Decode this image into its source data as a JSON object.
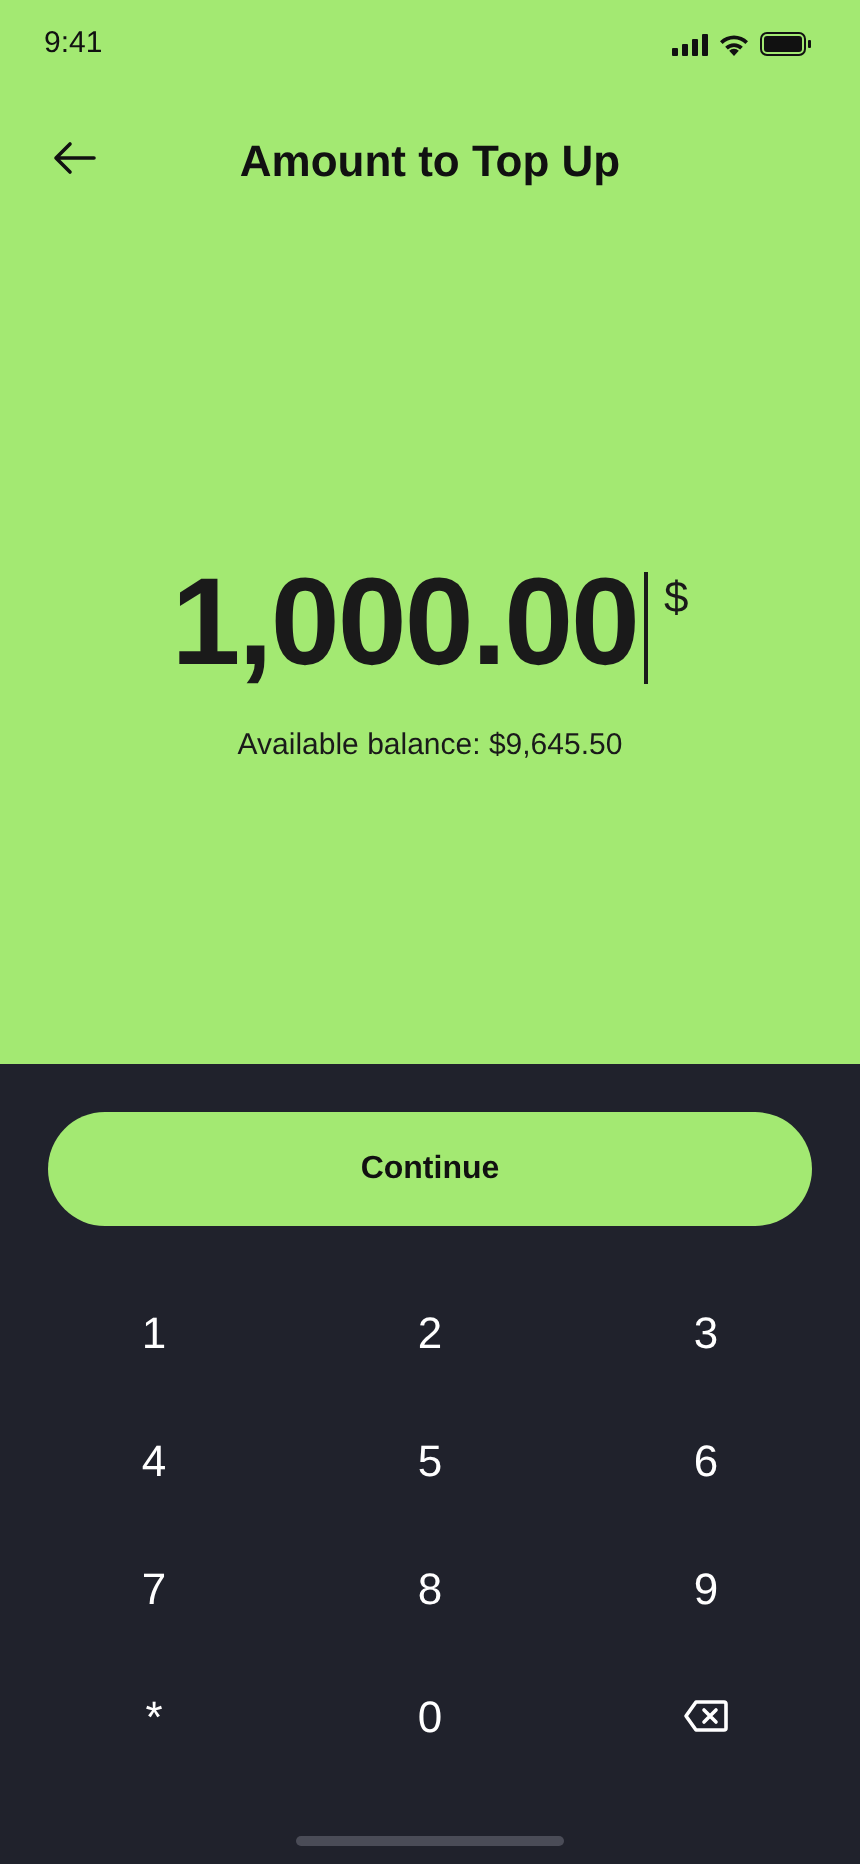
{
  "status_bar": {
    "time": "9:41"
  },
  "header": {
    "title": "Amount to Top Up"
  },
  "amount": {
    "value": "1,000.00",
    "currency": "$"
  },
  "balance": "Available balance: $9,645.50",
  "continue_button": "Continue",
  "keypad": [
    {
      "kind": "digit",
      "label": "1"
    },
    {
      "kind": "digit",
      "label": "2"
    },
    {
      "kind": "digit",
      "label": "3"
    },
    {
      "kind": "digit",
      "label": "4"
    },
    {
      "kind": "digit",
      "label": "5"
    },
    {
      "kind": "digit",
      "label": "6"
    },
    {
      "kind": "digit",
      "label": "7"
    },
    {
      "kind": "digit",
      "label": "8"
    },
    {
      "kind": "digit",
      "label": "9"
    },
    {
      "kind": "digit",
      "label": "*"
    },
    {
      "kind": "digit",
      "label": "0"
    },
    {
      "kind": "backspace"
    }
  ]
}
